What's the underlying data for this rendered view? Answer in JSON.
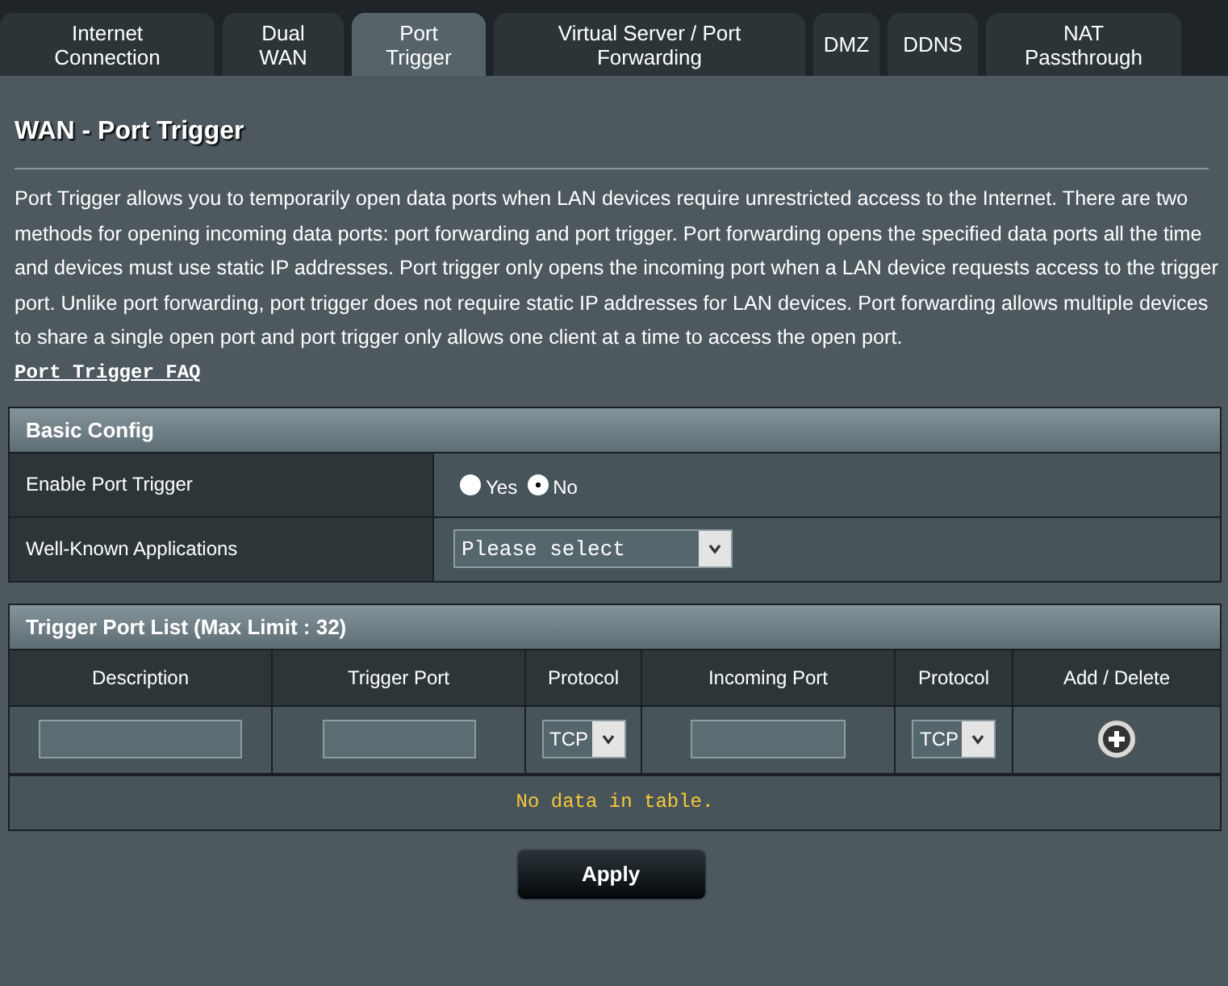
{
  "tabs": [
    {
      "label": "Internet Connection",
      "selected": false
    },
    {
      "label": "Dual WAN",
      "selected": false
    },
    {
      "label": "Port Trigger",
      "selected": true
    },
    {
      "label": "Virtual Server / Port Forwarding",
      "selected": false
    },
    {
      "label": "DMZ",
      "selected": false
    },
    {
      "label": "DDNS",
      "selected": false
    },
    {
      "label": "NAT Passthrough",
      "selected": false
    }
  ],
  "page_title": "WAN - Port Trigger",
  "description": "Port Trigger allows you to temporarily open data ports when LAN devices require unrestricted access to the Internet. There are two methods for opening incoming data ports: port forwarding and port trigger. Port forwarding opens the specified data ports all the time and devices must use static IP addresses. Port trigger only opens the incoming port when a LAN device requests access to the trigger port. Unlike port forwarding, port trigger does not require static IP addresses for LAN devices. Port forwarding allows multiple devices to share a single open port and port trigger only allows one client at a time to access the open port.",
  "faq_link": "Port Trigger FAQ",
  "basic_config": {
    "title": "Basic Config",
    "rows": [
      {
        "kind": "radio",
        "label": "Enable Port Trigger",
        "options": [
          {
            "label": "Yes",
            "selected": false
          },
          {
            "label": "No",
            "selected": true
          }
        ]
      },
      {
        "kind": "select",
        "label": "Well-Known Applications",
        "value": "Please select"
      }
    ]
  },
  "trigger_list": {
    "title": "Trigger Port List (Max Limit : 32)",
    "columns": [
      "Description",
      "Trigger Port",
      "Protocol",
      "Incoming Port",
      "Protocol",
      "Add / Delete"
    ],
    "input_row": [
      {
        "kind": "text"
      },
      {
        "kind": "text"
      },
      {
        "kind": "select",
        "value": "TCP"
      },
      {
        "kind": "text"
      },
      {
        "kind": "select",
        "value": "TCP"
      },
      {
        "kind": "add"
      }
    ],
    "empty_message": "No data in table."
  },
  "apply_button": "Apply"
}
